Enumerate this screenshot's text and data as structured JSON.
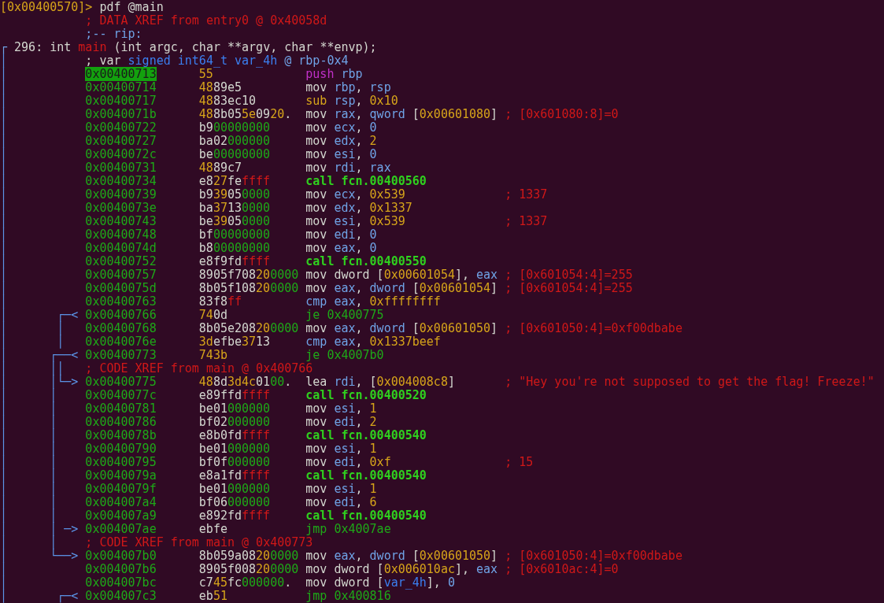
{
  "lines": [
    {
      "kind": "prompt",
      "tokens": [
        {
          "text": "[0x00400570]>",
          "kind": "number"
        },
        {
          "text": " pdf @main",
          "kind": "plain"
        }
      ]
    },
    {
      "kind": "note",
      "tokens": [
        {
          "text": "; DATA XREF from entry0 @ 0x40058d",
          "kind": "comment"
        }
      ]
    },
    {
      "kind": "note",
      "tokens": [
        {
          "text": ";-- rip:",
          "kind": "register"
        }
      ]
    },
    {
      "kind": "signature",
      "tokens": [
        {
          "text": "┌",
          "kind": "register"
        },
        {
          "text": " 296: int ",
          "kind": "plain"
        },
        {
          "text": "main",
          "kind": "comment"
        },
        {
          "text": " (int argc, char **argv, char **envp);",
          "kind": "plain"
        }
      ]
    },
    {
      "kind": "note",
      "gutter": "│",
      "tokens": [
        {
          "text": "; var ",
          "kind": "plain"
        },
        {
          "text": "signed int64_t var_4h",
          "kind": "variable"
        },
        {
          "text": " @ rbp-0x4",
          "kind": "register"
        }
      ]
    },
    {
      "kind": "code",
      "gutter": "│",
      "addr": "0x00400713",
      "current": true,
      "bytes": [
        {
          "text": "55",
          "kind": "number"
        }
      ],
      "asm": [
        {
          "text": "push",
          "kind": "push"
        },
        {
          "text": " rbp",
          "kind": "register"
        }
      ]
    },
    {
      "kind": "code",
      "gutter": "│",
      "addr": "0x00400714",
      "current": false,
      "bytes": [
        {
          "text": "48",
          "kind": "number"
        },
        {
          "text": "89e5",
          "kind": "plain"
        }
      ],
      "asm": [
        {
          "text": "mov ",
          "kind": "plain"
        },
        {
          "text": "rbp",
          "kind": "register"
        },
        {
          "text": ", ",
          "kind": "plain"
        },
        {
          "text": "rsp",
          "kind": "register"
        }
      ]
    },
    {
      "kind": "code",
      "gutter": "│",
      "addr": "0x00400717",
      "current": false,
      "bytes": [
        {
          "text": "48",
          "kind": "number"
        },
        {
          "text": "83ec10",
          "kind": "plain"
        }
      ],
      "asm": [
        {
          "text": "sub ",
          "kind": "number"
        },
        {
          "text": "rsp",
          "kind": "register"
        },
        {
          "text": ", ",
          "kind": "plain"
        },
        {
          "text": "0x10",
          "kind": "number"
        }
      ]
    },
    {
      "kind": "code",
      "gutter": "│",
      "addr": "0x0040071b",
      "current": false,
      "bytes": [
        {
          "text": "48",
          "kind": "number"
        },
        {
          "text": "8b05",
          "kind": "plain"
        },
        {
          "text": "5e",
          "kind": "number"
        },
        {
          "text": "09",
          "kind": "plain"
        },
        {
          "text": "20",
          "kind": "number"
        },
        {
          "text": ".",
          "kind": "plain"
        }
      ],
      "asm": [
        {
          "text": "mov ",
          "kind": "plain"
        },
        {
          "text": "rax",
          "kind": "register"
        },
        {
          "text": ", ",
          "kind": "plain"
        },
        {
          "text": "qword",
          "kind": "register"
        },
        {
          "text": " [",
          "kind": "plain"
        },
        {
          "text": "0x00601080",
          "kind": "number"
        },
        {
          "text": "]",
          "kind": "plain"
        }
      ],
      "comment": "; [0x601080:8]=0"
    },
    {
      "kind": "code",
      "gutter": "│",
      "addr": "0x00400722",
      "current": false,
      "bytes": [
        {
          "text": "b9",
          "kind": "plain"
        },
        {
          "text": "00000000",
          "kind": "zero"
        }
      ],
      "asm": [
        {
          "text": "mov ",
          "kind": "plain"
        },
        {
          "text": "ecx",
          "kind": "register"
        },
        {
          "text": ", ",
          "kind": "plain"
        },
        {
          "text": "0",
          "kind": "register"
        }
      ]
    },
    {
      "kind": "code",
      "gutter": "│",
      "addr": "0x00400727",
      "current": false,
      "bytes": [
        {
          "text": "ba02",
          "kind": "plain"
        },
        {
          "text": "000000",
          "kind": "zero"
        }
      ],
      "asm": [
        {
          "text": "mov ",
          "kind": "plain"
        },
        {
          "text": "edx",
          "kind": "register"
        },
        {
          "text": ", ",
          "kind": "plain"
        },
        {
          "text": "2",
          "kind": "number"
        }
      ]
    },
    {
      "kind": "code",
      "gutter": "│",
      "addr": "0x0040072c",
      "current": false,
      "bytes": [
        {
          "text": "be",
          "kind": "plain"
        },
        {
          "text": "00000000",
          "kind": "zero"
        }
      ],
      "asm": [
        {
          "text": "mov ",
          "kind": "plain"
        },
        {
          "text": "esi",
          "kind": "register"
        },
        {
          "text": ", ",
          "kind": "plain"
        },
        {
          "text": "0",
          "kind": "register"
        }
      ]
    },
    {
      "kind": "code",
      "gutter": "│",
      "addr": "0x00400731",
      "current": false,
      "bytes": [
        {
          "text": "48",
          "kind": "number"
        },
        {
          "text": "89c7",
          "kind": "plain"
        }
      ],
      "asm": [
        {
          "text": "mov ",
          "kind": "plain"
        },
        {
          "text": "rdi",
          "kind": "register"
        },
        {
          "text": ", ",
          "kind": "plain"
        },
        {
          "text": "rax",
          "kind": "register"
        }
      ]
    },
    {
      "kind": "code",
      "gutter": "│",
      "addr": "0x00400734",
      "current": false,
      "bytes": [
        {
          "text": "e8",
          "kind": "plain"
        },
        {
          "text": "27",
          "kind": "number"
        },
        {
          "text": "fe",
          "kind": "plain"
        },
        {
          "text": "ffff",
          "kind": "comment"
        }
      ],
      "asm": [
        {
          "text": "call fcn.00400560",
          "kind": "call"
        }
      ]
    },
    {
      "kind": "code",
      "gutter": "│",
      "addr": "0x00400739",
      "current": false,
      "bytes": [
        {
          "text": "b9",
          "kind": "plain"
        },
        {
          "text": "39",
          "kind": "number"
        },
        {
          "text": "05",
          "kind": "plain"
        },
        {
          "text": "0000",
          "kind": "zero"
        }
      ],
      "asm": [
        {
          "text": "mov ",
          "kind": "plain"
        },
        {
          "text": "ecx",
          "kind": "register"
        },
        {
          "text": ", ",
          "kind": "plain"
        },
        {
          "text": "0x539",
          "kind": "number"
        }
      ],
      "comment": "; 1337"
    },
    {
      "kind": "code",
      "gutter": "│",
      "addr": "0x0040073e",
      "current": false,
      "bytes": [
        {
          "text": "ba",
          "kind": "plain"
        },
        {
          "text": "37",
          "kind": "number"
        },
        {
          "text": "13",
          "kind": "plain"
        },
        {
          "text": "0000",
          "kind": "zero"
        }
      ],
      "asm": [
        {
          "text": "mov ",
          "kind": "plain"
        },
        {
          "text": "edx",
          "kind": "register"
        },
        {
          "text": ", ",
          "kind": "plain"
        },
        {
          "text": "0x1337",
          "kind": "number"
        }
      ]
    },
    {
      "kind": "code",
      "gutter": "│",
      "addr": "0x00400743",
      "current": false,
      "bytes": [
        {
          "text": "be",
          "kind": "plain"
        },
        {
          "text": "39",
          "kind": "number"
        },
        {
          "text": "05",
          "kind": "plain"
        },
        {
          "text": "0000",
          "kind": "zero"
        }
      ],
      "asm": [
        {
          "text": "mov ",
          "kind": "plain"
        },
        {
          "text": "esi",
          "kind": "register"
        },
        {
          "text": ", ",
          "kind": "plain"
        },
        {
          "text": "0x539",
          "kind": "number"
        }
      ],
      "comment": "; 1337"
    },
    {
      "kind": "code",
      "gutter": "│",
      "addr": "0x00400748",
      "current": false,
      "bytes": [
        {
          "text": "bf",
          "kind": "plain"
        },
        {
          "text": "00000000",
          "kind": "zero"
        }
      ],
      "asm": [
        {
          "text": "mov ",
          "kind": "plain"
        },
        {
          "text": "edi",
          "kind": "register"
        },
        {
          "text": ", ",
          "kind": "plain"
        },
        {
          "text": "0",
          "kind": "register"
        }
      ]
    },
    {
      "kind": "code",
      "gutter": "│",
      "addr": "0x0040074d",
      "current": false,
      "bytes": [
        {
          "text": "b8",
          "kind": "plain"
        },
        {
          "text": "00000000",
          "kind": "zero"
        }
      ],
      "asm": [
        {
          "text": "mov ",
          "kind": "plain"
        },
        {
          "text": "eax",
          "kind": "register"
        },
        {
          "text": ", ",
          "kind": "plain"
        },
        {
          "text": "0",
          "kind": "register"
        }
      ]
    },
    {
      "kind": "code",
      "gutter": "│",
      "addr": "0x00400752",
      "current": false,
      "bytes": [
        {
          "text": "e8f9fd",
          "kind": "plain"
        },
        {
          "text": "ffff",
          "kind": "comment"
        }
      ],
      "asm": [
        {
          "text": "call fcn.00400550",
          "kind": "call"
        }
      ]
    },
    {
      "kind": "code",
      "gutter": "│",
      "addr": "0x00400757",
      "current": false,
      "bytes": [
        {
          "text": "8905f708",
          "kind": "plain"
        },
        {
          "text": "20",
          "kind": "number"
        },
        {
          "text": "0000",
          "kind": "zero"
        }
      ],
      "asm": [
        {
          "text": "mov dword [",
          "kind": "plain"
        },
        {
          "text": "0x00601054",
          "kind": "number"
        },
        {
          "text": "], ",
          "kind": "plain"
        },
        {
          "text": "eax",
          "kind": "register"
        }
      ],
      "comment": "; [0x601054:4]=255"
    },
    {
      "kind": "code",
      "gutter": "│",
      "addr": "0x0040075d",
      "current": false,
      "bytes": [
        {
          "text": "8b05f108",
          "kind": "plain"
        },
        {
          "text": "20",
          "kind": "number"
        },
        {
          "text": "0000",
          "kind": "zero"
        }
      ],
      "asm": [
        {
          "text": "mov ",
          "kind": "plain"
        },
        {
          "text": "eax",
          "kind": "register"
        },
        {
          "text": ", ",
          "kind": "plain"
        },
        {
          "text": "dword",
          "kind": "register"
        },
        {
          "text": " [",
          "kind": "plain"
        },
        {
          "text": "0x00601054",
          "kind": "number"
        },
        {
          "text": "]",
          "kind": "plain"
        }
      ],
      "comment": "; [0x601054:4]=255"
    },
    {
      "kind": "code",
      "gutter": "│",
      "addr": "0x00400763",
      "current": false,
      "bytes": [
        {
          "text": "83f8",
          "kind": "plain"
        },
        {
          "text": "ff",
          "kind": "comment"
        }
      ],
      "asm": [
        {
          "text": "cmp eax",
          "kind": "register"
        },
        {
          "text": ", ",
          "kind": "plain"
        },
        {
          "text": "0xffffffff",
          "kind": "number"
        }
      ]
    },
    {
      "kind": "code",
      "gutter": "│       ┌─<",
      "addr": "0x00400766",
      "current": false,
      "bytes": [
        {
          "text": "74",
          "kind": "number"
        },
        {
          "text": "0d",
          "kind": "plain"
        }
      ],
      "asm": [
        {
          "text": "je 0x400775",
          "kind": "jump"
        }
      ]
    },
    {
      "kind": "code",
      "gutter": "│       │",
      "addr": "0x00400768",
      "current": false,
      "bytes": [
        {
          "text": "8b05e208",
          "kind": "plain"
        },
        {
          "text": "20",
          "kind": "number"
        },
        {
          "text": "0000",
          "kind": "zero"
        }
      ],
      "asm": [
        {
          "text": "mov ",
          "kind": "plain"
        },
        {
          "text": "eax",
          "kind": "register"
        },
        {
          "text": ", ",
          "kind": "plain"
        },
        {
          "text": "dword",
          "kind": "register"
        },
        {
          "text": " [",
          "kind": "plain"
        },
        {
          "text": "0x00601050",
          "kind": "number"
        },
        {
          "text": "]",
          "kind": "plain"
        }
      ],
      "comment": "; [0x601050:4]=0xf00dbabe"
    },
    {
      "kind": "code",
      "gutter": "│       │",
      "addr": "0x0040076e",
      "current": false,
      "bytes": [
        {
          "text": "3d",
          "kind": "number"
        },
        {
          "text": "efbe",
          "kind": "plain"
        },
        {
          "text": "37",
          "kind": "number"
        },
        {
          "text": "13",
          "kind": "plain"
        }
      ],
      "asm": [
        {
          "text": "cmp eax",
          "kind": "register"
        },
        {
          "text": ", ",
          "kind": "plain"
        },
        {
          "text": "0x1337beef",
          "kind": "number"
        }
      ]
    },
    {
      "kind": "code",
      "gutter": "│      ┌──<",
      "addr": "0x00400773",
      "current": false,
      "bytes": [
        {
          "text": "743b",
          "kind": "number"
        }
      ],
      "asm": [
        {
          "text": "je 0x4007b0",
          "kind": "jump"
        }
      ]
    },
    {
      "kind": "note",
      "gutter": "│      ││",
      "tokens": [
        {
          "text": "; CODE XREF from main @ 0x400766",
          "kind": "comment"
        }
      ]
    },
    {
      "kind": "code",
      "gutter": "│      │└─>",
      "addr": "0x00400775",
      "current": false,
      "bytes": [
        {
          "text": "48",
          "kind": "number"
        },
        {
          "text": "8d",
          "kind": "plain"
        },
        {
          "text": "3d4c",
          "kind": "number"
        },
        {
          "text": "01",
          "kind": "plain"
        },
        {
          "text": "00",
          "kind": "zero"
        },
        {
          "text": ".",
          "kind": "plain"
        }
      ],
      "asm": [
        {
          "text": "lea ",
          "kind": "plain"
        },
        {
          "text": "rdi",
          "kind": "register"
        },
        {
          "text": ", [",
          "kind": "plain"
        },
        {
          "text": "0x004008c8",
          "kind": "number"
        },
        {
          "text": "]",
          "kind": "plain"
        }
      ],
      "comment": "; \"Hey you're not supposed to get the flag! Freeze!\""
    },
    {
      "kind": "code",
      "gutter": "│      │",
      "addr": "0x0040077c",
      "current": false,
      "bytes": [
        {
          "text": "e89ffd",
          "kind": "plain"
        },
        {
          "text": "ffff",
          "kind": "comment"
        }
      ],
      "asm": [
        {
          "text": "call fcn.00400520",
          "kind": "call"
        }
      ]
    },
    {
      "kind": "code",
      "gutter": "│      │",
      "addr": "0x00400781",
      "current": false,
      "bytes": [
        {
          "text": "be01",
          "kind": "plain"
        },
        {
          "text": "000000",
          "kind": "zero"
        }
      ],
      "asm": [
        {
          "text": "mov ",
          "kind": "plain"
        },
        {
          "text": "esi",
          "kind": "register"
        },
        {
          "text": ", ",
          "kind": "plain"
        },
        {
          "text": "1",
          "kind": "number"
        }
      ]
    },
    {
      "kind": "code",
      "gutter": "│      │",
      "addr": "0x00400786",
      "current": false,
      "bytes": [
        {
          "text": "bf02",
          "kind": "plain"
        },
        {
          "text": "000000",
          "kind": "zero"
        }
      ],
      "asm": [
        {
          "text": "mov ",
          "kind": "plain"
        },
        {
          "text": "edi",
          "kind": "register"
        },
        {
          "text": ", ",
          "kind": "plain"
        },
        {
          "text": "2",
          "kind": "number"
        }
      ]
    },
    {
      "kind": "code",
      "gutter": "│      │",
      "addr": "0x0040078b",
      "current": false,
      "bytes": [
        {
          "text": "e8b0fd",
          "kind": "plain"
        },
        {
          "text": "ffff",
          "kind": "comment"
        }
      ],
      "asm": [
        {
          "text": "call fcn.00400540",
          "kind": "call"
        }
      ]
    },
    {
      "kind": "code",
      "gutter": "│      │",
      "addr": "0x00400790",
      "current": false,
      "bytes": [
        {
          "text": "be01",
          "kind": "plain"
        },
        {
          "text": "000000",
          "kind": "zero"
        }
      ],
      "asm": [
        {
          "text": "mov ",
          "kind": "plain"
        },
        {
          "text": "esi",
          "kind": "register"
        },
        {
          "text": ", ",
          "kind": "plain"
        },
        {
          "text": "1",
          "kind": "number"
        }
      ]
    },
    {
      "kind": "code",
      "gutter": "│      │",
      "addr": "0x00400795",
      "current": false,
      "bytes": [
        {
          "text": "bf0f",
          "kind": "plain"
        },
        {
          "text": "000000",
          "kind": "zero"
        }
      ],
      "asm": [
        {
          "text": "mov ",
          "kind": "plain"
        },
        {
          "text": "edi",
          "kind": "register"
        },
        {
          "text": ", ",
          "kind": "plain"
        },
        {
          "text": "0xf",
          "kind": "number"
        }
      ],
      "comment": "; 15"
    },
    {
      "kind": "code",
      "gutter": "│      │",
      "addr": "0x0040079a",
      "current": false,
      "bytes": [
        {
          "text": "e8a1fd",
          "kind": "plain"
        },
        {
          "text": "ffff",
          "kind": "comment"
        }
      ],
      "asm": [
        {
          "text": "call fcn.00400540",
          "kind": "call"
        }
      ]
    },
    {
      "kind": "code",
      "gutter": "│      │",
      "addr": "0x0040079f",
      "current": false,
      "bytes": [
        {
          "text": "be01",
          "kind": "plain"
        },
        {
          "text": "000000",
          "kind": "zero"
        }
      ],
      "asm": [
        {
          "text": "mov ",
          "kind": "plain"
        },
        {
          "text": "esi",
          "kind": "register"
        },
        {
          "text": ", ",
          "kind": "plain"
        },
        {
          "text": "1",
          "kind": "number"
        }
      ]
    },
    {
      "kind": "code",
      "gutter": "│      │",
      "addr": "0x004007a4",
      "current": false,
      "bytes": [
        {
          "text": "bf06",
          "kind": "plain"
        },
        {
          "text": "000000",
          "kind": "zero"
        }
      ],
      "asm": [
        {
          "text": "mov ",
          "kind": "plain"
        },
        {
          "text": "edi",
          "kind": "register"
        },
        {
          "text": ", ",
          "kind": "plain"
        },
        {
          "text": "6",
          "kind": "number"
        }
      ]
    },
    {
      "kind": "code",
      "gutter": "│      │",
      "addr": "0x004007a9",
      "current": false,
      "bytes": [
        {
          "text": "e892fd",
          "kind": "plain"
        },
        {
          "text": "ffff",
          "kind": "comment"
        }
      ],
      "asm": [
        {
          "text": "call fcn.00400540",
          "kind": "call"
        }
      ]
    },
    {
      "kind": "code",
      "gutter": "│      │ ─>",
      "addr": "0x004007ae",
      "current": false,
      "bytes": [
        {
          "text": "ebfe",
          "kind": "plain"
        }
      ],
      "asm": [
        {
          "text": "jmp 0x4007ae",
          "kind": "jump"
        }
      ]
    },
    {
      "kind": "note",
      "gutter": "│      │",
      "tokens": [
        {
          "text": "; CODE XREF from main @ 0x400773",
          "kind": "comment"
        }
      ]
    },
    {
      "kind": "code",
      "gutter": "│      └──>",
      "addr": "0x004007b0",
      "current": false,
      "bytes": [
        {
          "text": "8b059a08",
          "kind": "plain"
        },
        {
          "text": "20",
          "kind": "number"
        },
        {
          "text": "0000",
          "kind": "zero"
        }
      ],
      "asm": [
        {
          "text": "mov ",
          "kind": "plain"
        },
        {
          "text": "eax",
          "kind": "register"
        },
        {
          "text": ", ",
          "kind": "plain"
        },
        {
          "text": "dword",
          "kind": "register"
        },
        {
          "text": " [",
          "kind": "plain"
        },
        {
          "text": "0x00601050",
          "kind": "number"
        },
        {
          "text": "]",
          "kind": "plain"
        }
      ],
      "comment": "; [0x601050:4]=0xf00dbabe"
    },
    {
      "kind": "code",
      "gutter": "│",
      "addr": "0x004007b6",
      "current": false,
      "bytes": [
        {
          "text": "8905f008",
          "kind": "plain"
        },
        {
          "text": "20",
          "kind": "number"
        },
        {
          "text": "0000",
          "kind": "zero"
        }
      ],
      "asm": [
        {
          "text": "mov dword [",
          "kind": "plain"
        },
        {
          "text": "0x006010ac",
          "kind": "number"
        },
        {
          "text": "], ",
          "kind": "plain"
        },
        {
          "text": "eax",
          "kind": "register"
        }
      ],
      "comment": "; [0x6010ac:4]=0"
    },
    {
      "kind": "code",
      "gutter": "│",
      "addr": "0x004007bc",
      "current": false,
      "bytes": [
        {
          "text": "c7",
          "kind": "plain"
        },
        {
          "text": "45",
          "kind": "number"
        },
        {
          "text": "fc",
          "kind": "plain"
        },
        {
          "text": "000000",
          "kind": "zero"
        },
        {
          "text": ".",
          "kind": "plain"
        }
      ],
      "asm": [
        {
          "text": "mov dword [",
          "kind": "plain"
        },
        {
          "text": "var_4h",
          "kind": "variable"
        },
        {
          "text": "], ",
          "kind": "plain"
        },
        {
          "text": "0",
          "kind": "register"
        }
      ]
    },
    {
      "kind": "code",
      "gutter": "│       ┌─<",
      "addr": "0x004007c3",
      "current": false,
      "bytes": [
        {
          "text": "eb",
          "kind": "plain"
        },
        {
          "text": "51",
          "kind": "number"
        }
      ],
      "asm": [
        {
          "text": "jmp 0x400816",
          "kind": "jump"
        }
      ]
    }
  ]
}
